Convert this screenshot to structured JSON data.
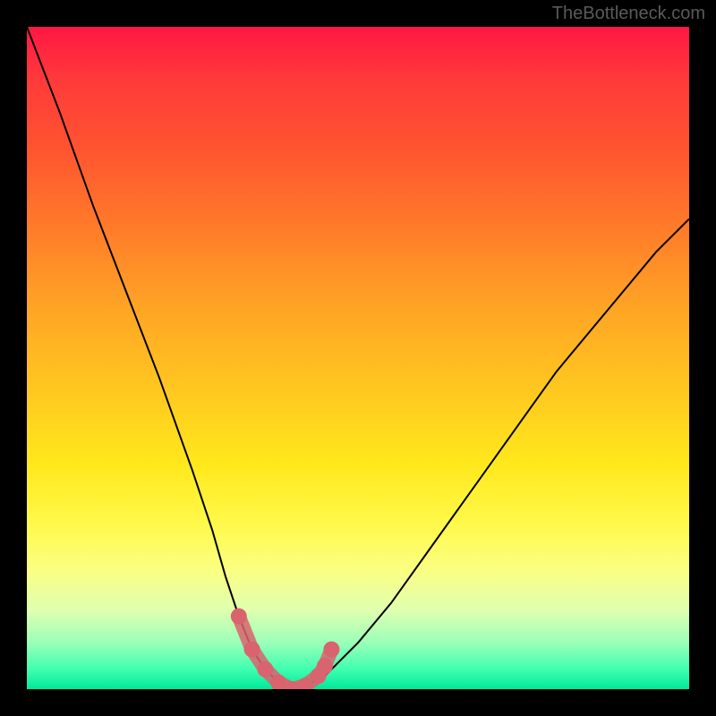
{
  "watermark": "TheBottleneck.com",
  "chart_data": {
    "type": "line",
    "title": "",
    "xlabel": "",
    "ylabel": "",
    "xlim": [
      0,
      100
    ],
    "ylim": [
      0,
      100
    ],
    "gradient_background": {
      "orientation": "vertical",
      "stops": [
        {
          "pos": 0,
          "color": "#ff1744"
        },
        {
          "pos": 50,
          "color": "#ffc520"
        },
        {
          "pos": 80,
          "color": "#fbff82"
        },
        {
          "pos": 100,
          "color": "#00e89a"
        }
      ]
    },
    "series": [
      {
        "name": "bottleneck-curve",
        "color": "#000000",
        "x": [
          0,
          5,
          10,
          15,
          20,
          25,
          28,
          30,
          32,
          34,
          36,
          38,
          40,
          42,
          45,
          50,
          55,
          60,
          65,
          70,
          75,
          80,
          85,
          90,
          95,
          100
        ],
        "values": [
          100,
          87,
          73,
          60,
          47,
          33,
          24,
          17,
          11,
          6,
          3,
          1,
          0,
          0.5,
          2,
          7,
          13,
          20,
          27,
          34,
          41,
          48,
          54,
          60,
          66,
          71
        ]
      },
      {
        "name": "highlight-points",
        "color": "#d9636f",
        "type": "scatter",
        "x": [
          32,
          34,
          36,
          38,
          40,
          42,
          44,
          45,
          46
        ],
        "values": [
          11,
          6,
          3,
          1,
          0,
          0.5,
          2,
          3.5,
          6
        ]
      }
    ]
  }
}
